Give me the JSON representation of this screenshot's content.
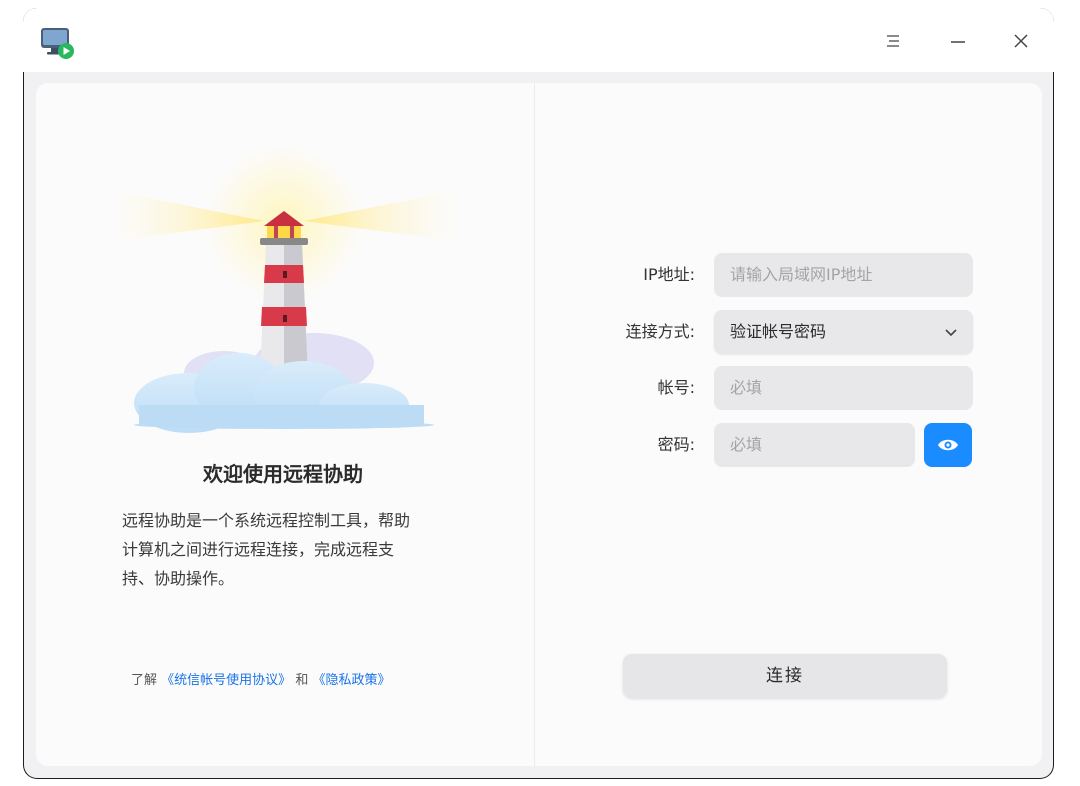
{
  "window": {
    "app_icon": "remote-desktop-icon",
    "controls": {
      "menu": "menu-icon",
      "minimize": "minimize-icon",
      "close": "close-icon"
    }
  },
  "left": {
    "illustration": "lighthouse-illustration",
    "title": "欢迎使用远程协助",
    "desc_lines": [
      "远程协助是一个系统远程控制工具，帮助",
      "计算机之间进行远程连接，完成远程支",
      "持、协助操作。"
    ],
    "agreement": {
      "prefix": "了解",
      "link1": "《统信帐号使用协议》",
      "middle": "和",
      "link2": "《隐私政策》"
    }
  },
  "form": {
    "ip_label": "IP地址:",
    "ip_placeholder": "请输入局域网IP地址",
    "method_label": "连接方式:",
    "method_value": "验证帐号密码",
    "account_label": "帐号:",
    "account_placeholder": "必填",
    "password_label": "密码:",
    "password_placeholder": "必填",
    "connect_label": "连接"
  },
  "colors": {
    "accent": "#1a8cff",
    "link": "#1a73e8"
  }
}
